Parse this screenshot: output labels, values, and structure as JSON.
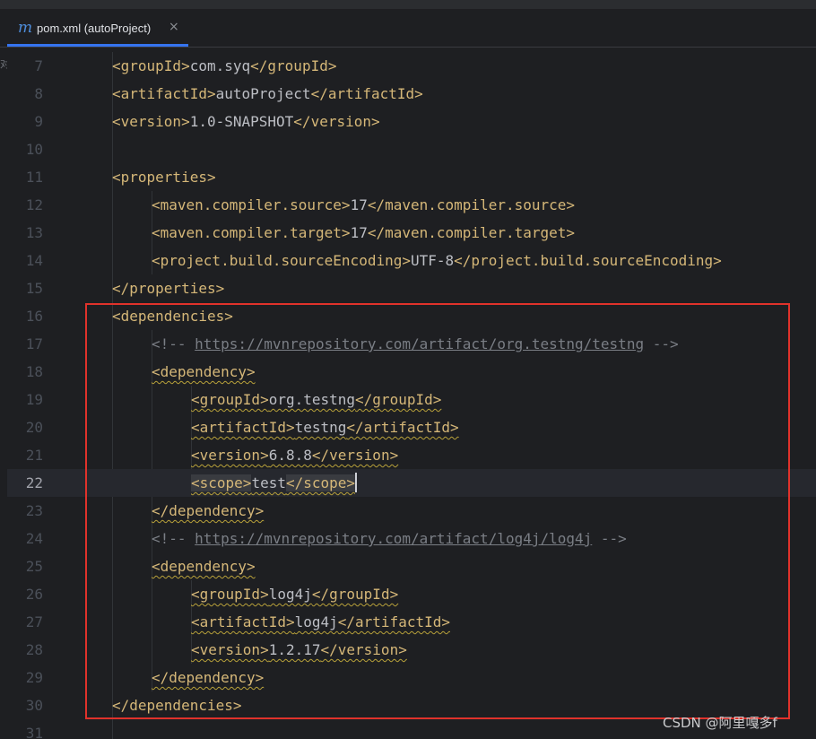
{
  "tab": {
    "icon_char": "m",
    "icon": "maven-file-icon",
    "title": "pom.xml (autoProject)",
    "close": "×"
  },
  "gutter_mark": "对",
  "current_line": 22,
  "lines": [
    {
      "num": "7",
      "indent": 1,
      "parts": [
        [
          "tag",
          "<groupId>"
        ],
        [
          "txt",
          "com.syq"
        ],
        [
          "tag",
          "</groupId>"
        ]
      ]
    },
    {
      "num": "8",
      "indent": 1,
      "parts": [
        [
          "tag",
          "<artifactId>"
        ],
        [
          "txt",
          "autoProject"
        ],
        [
          "tag",
          "</artifactId>"
        ]
      ]
    },
    {
      "num": "9",
      "indent": 1,
      "parts": [
        [
          "tag",
          "<version>"
        ],
        [
          "txt",
          "1.0-SNAPSHOT"
        ],
        [
          "tag",
          "</version>"
        ]
      ]
    },
    {
      "num": "10",
      "indent": 0,
      "parts": []
    },
    {
      "num": "11",
      "indent": 1,
      "parts": [
        [
          "tag",
          "<properties>"
        ]
      ]
    },
    {
      "num": "12",
      "indent": 2,
      "parts": [
        [
          "tag",
          "<maven.compiler.source>"
        ],
        [
          "txt",
          "17"
        ],
        [
          "tag",
          "</maven.compiler.source>"
        ]
      ]
    },
    {
      "num": "13",
      "indent": 2,
      "parts": [
        [
          "tag",
          "<maven.compiler.target>"
        ],
        [
          "txt",
          "17"
        ],
        [
          "tag",
          "</maven.compiler.target>"
        ]
      ]
    },
    {
      "num": "14",
      "indent": 2,
      "parts": [
        [
          "tag",
          "<project.build.sourceEncoding>"
        ],
        [
          "txt",
          "UTF-8"
        ],
        [
          "tag",
          "</project.build.sourceEncoding>"
        ]
      ]
    },
    {
      "num": "15",
      "indent": 1,
      "parts": [
        [
          "tag",
          "</properties>"
        ]
      ]
    },
    {
      "num": "16",
      "indent": 1,
      "parts": [
        [
          "tag",
          "<dependencies>"
        ]
      ]
    },
    {
      "num": "17",
      "indent": 2,
      "parts": [
        [
          "cmt",
          "<!-- "
        ],
        [
          "url",
          "https://mvnrepository.com/artifact/org.testng/testng"
        ],
        [
          "cmt",
          " -->"
        ]
      ]
    },
    {
      "num": "18",
      "indent": 2,
      "warn": true,
      "parts": [
        [
          "tag",
          "<dependency>"
        ]
      ]
    },
    {
      "num": "19",
      "indent": 3,
      "warn": true,
      "parts": [
        [
          "tag",
          "<groupId>"
        ],
        [
          "txt",
          "org.testng"
        ],
        [
          "tag",
          "</groupId>"
        ]
      ]
    },
    {
      "num": "20",
      "indent": 3,
      "warn": true,
      "parts": [
        [
          "tag",
          "<artifactId>"
        ],
        [
          "txt",
          "testng"
        ],
        [
          "tag",
          "</artifactId>"
        ]
      ]
    },
    {
      "num": "21",
      "indent": 3,
      "warn": true,
      "parts": [
        [
          "tag",
          "<version>"
        ],
        [
          "txt",
          "6.8.8"
        ],
        [
          "tag",
          "</version>"
        ]
      ]
    },
    {
      "num": "22",
      "indent": 3,
      "warn": true,
      "caret": true,
      "parts": [
        [
          "taghl",
          "<scope>"
        ],
        [
          "txt",
          "test"
        ],
        [
          "taghl",
          "</scope>"
        ]
      ]
    },
    {
      "num": "23",
      "indent": 2,
      "warn": true,
      "parts": [
        [
          "tag",
          "</dependency>"
        ]
      ]
    },
    {
      "num": "24",
      "indent": 2,
      "parts": [
        [
          "cmt",
          "<!-- "
        ],
        [
          "url",
          "https://mvnrepository.com/artifact/log4j/log4j"
        ],
        [
          "cmt",
          " -->"
        ]
      ]
    },
    {
      "num": "25",
      "indent": 2,
      "warn": true,
      "parts": [
        [
          "tag",
          "<dependency>"
        ]
      ]
    },
    {
      "num": "26",
      "indent": 3,
      "warn": true,
      "parts": [
        [
          "tag",
          "<groupId>"
        ],
        [
          "txt",
          "log4j"
        ],
        [
          "tag",
          "</groupId>"
        ]
      ]
    },
    {
      "num": "27",
      "indent": 3,
      "warn": true,
      "parts": [
        [
          "tag",
          "<artifactId>"
        ],
        [
          "txt",
          "log4j"
        ],
        [
          "tag",
          "</artifactId>"
        ]
      ]
    },
    {
      "num": "28",
      "indent": 3,
      "warn": true,
      "parts": [
        [
          "tag",
          "<version>"
        ],
        [
          "txt",
          "1.2.17"
        ],
        [
          "tag",
          "</version>"
        ]
      ]
    },
    {
      "num": "29",
      "indent": 2,
      "warn": true,
      "parts": [
        [
          "tag",
          "</dependency>"
        ]
      ]
    },
    {
      "num": "30",
      "indent": 1,
      "parts": [
        [
          "tag",
          "</dependencies>"
        ]
      ]
    },
    {
      "num": "31",
      "indent": 0,
      "parts": []
    }
  ],
  "colors": {
    "tag": "#d5b778",
    "text": "#bcbec4",
    "comment": "#7a7e85",
    "annotation_box": "#e0322b",
    "tab_accent": "#3574f0"
  },
  "watermark": "CSDN @阿里嘎多f"
}
